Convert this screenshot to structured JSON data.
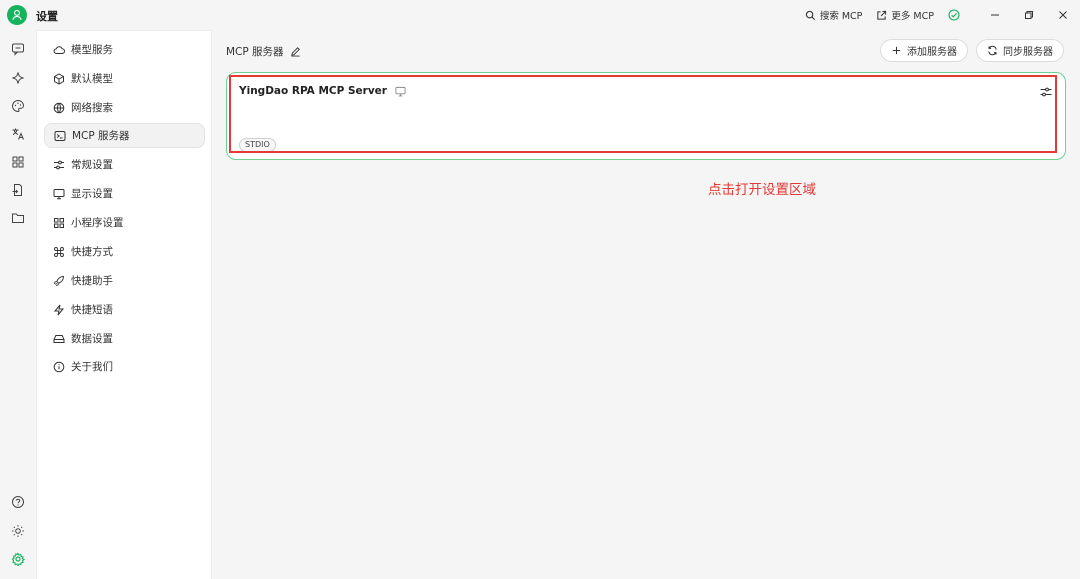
{
  "app": {
    "title": "设置"
  },
  "titlebar": {
    "search_mcp": "搜索 MCP",
    "more_mcp": "更多 MCP"
  },
  "sidebar": {
    "items": [
      {
        "label": "模型服务",
        "icon": "cloud-icon"
      },
      {
        "label": "默认模型",
        "icon": "cube-icon"
      },
      {
        "label": "网络搜索",
        "icon": "globe-icon"
      },
      {
        "label": "MCP 服务器",
        "icon": "terminal-icon",
        "active": true
      },
      {
        "label": "常规设置",
        "icon": "sliders-icon"
      },
      {
        "label": "显示设置",
        "icon": "monitor-icon"
      },
      {
        "label": "小程序设置",
        "icon": "grid-icon"
      },
      {
        "label": "快捷方式",
        "icon": "command-icon"
      },
      {
        "label": "快捷助手",
        "icon": "rocket-icon"
      },
      {
        "label": "快捷短语",
        "icon": "zap-icon"
      },
      {
        "label": "数据设置",
        "icon": "drive-icon"
      },
      {
        "label": "关于我们",
        "icon": "info-icon"
      }
    ]
  },
  "main": {
    "title": "MCP 服务器",
    "add_label": "添加服务器",
    "sync_label": "同步服务器",
    "server": {
      "name": "YingDao RPA MCP Server",
      "tag": "STDIO"
    },
    "annotation": "点击打开设置区域"
  },
  "colors": {
    "brand": "#16b35d",
    "active_border": "#6fcf97",
    "highlight": "#e53935"
  }
}
